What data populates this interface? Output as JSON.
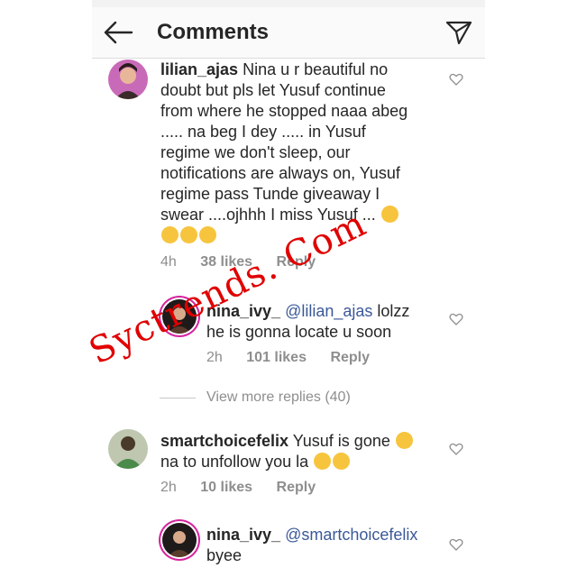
{
  "header": {
    "back_icon": "arrow-left-icon",
    "title": "Comments",
    "send_icon": "direct-send-icon"
  },
  "comments": [
    {
      "username": "lilian_ajas",
      "text": "Nina u r beautiful no doubt but pls let Yusuf continue from where he stopped naaa abeg ..... na beg I dey ..... in Yusuf regime we don't sleep, our notifications are always on, Yusuf regime pass Tunde giveaway I swear ....ojhhh I miss Yusuf ...",
      "emojis": [
        "crying-face",
        "crying-face",
        "crying-face",
        "crying-face"
      ],
      "time": "4h",
      "likes": "38 likes",
      "reply": "Reply"
    },
    {
      "username": "nina_ivy_",
      "mention": "@lilian_ajas",
      "text": "lolzz he is gonna locate u soon",
      "time": "2h",
      "likes": "101 likes",
      "reply": "Reply"
    },
    {
      "username": "smartchoicefelix",
      "text": "Yusuf is gone",
      "text2": "na to unfollow you la",
      "emojis": [
        "confused-face",
        "grimacing-face",
        "grimacing-face"
      ],
      "time": "2h",
      "likes": "10 likes",
      "reply": "Reply"
    },
    {
      "username": "nina_ivy_",
      "mention": "@smartchoicefelix",
      "text": "byee"
    }
  ],
  "view_more": "View more replies (40)",
  "watermark": "Syctrends. Com",
  "colors": {
    "mention": "#3b5998",
    "muted": "#8e8e8e",
    "story_ring": "#d6249f",
    "watermark": "#e00000"
  }
}
